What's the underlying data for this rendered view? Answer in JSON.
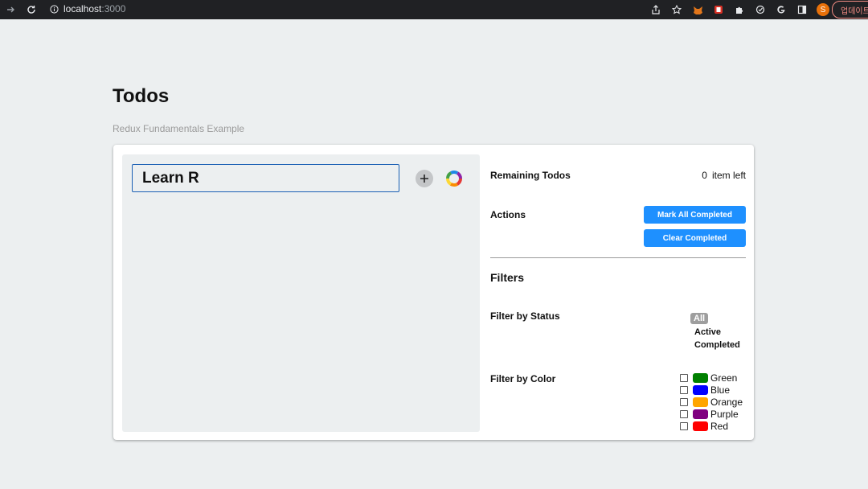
{
  "browser": {
    "url_host": "localhost",
    "url_port": ":3000",
    "profile_initial": "S",
    "update_label": "업데이트"
  },
  "page": {
    "title": "Todos",
    "subtitle": "Redux Fundamentals Example"
  },
  "todo_input": {
    "value": "Learn R"
  },
  "footer": {
    "remaining_label": "Remaining Todos",
    "remaining_count": "0",
    "remaining_suffix": "item left",
    "actions_label": "Actions",
    "mark_all_completed": "Mark All Completed",
    "clear_completed": "Clear Completed",
    "filters_heading": "Filters",
    "filter_by_status_label": "Filter by Status",
    "status_options": [
      {
        "label": "All",
        "selected": true
      },
      {
        "label": "Active",
        "selected": false
      },
      {
        "label": "Completed",
        "selected": false
      }
    ],
    "filter_by_color_label": "Filter by Color",
    "color_options": [
      {
        "label": "Green",
        "color": "#008000"
      },
      {
        "label": "Blue",
        "color": "#0000ff"
      },
      {
        "label": "Orange",
        "color": "#ffa500"
      },
      {
        "label": "Purple",
        "color": "#800080"
      },
      {
        "label": "Red",
        "color": "#ff0000"
      }
    ]
  },
  "colors": {
    "accent_button": "#1e90ff",
    "input_border": "#1a5fb4",
    "selected_filter": "#9e9e9e"
  }
}
